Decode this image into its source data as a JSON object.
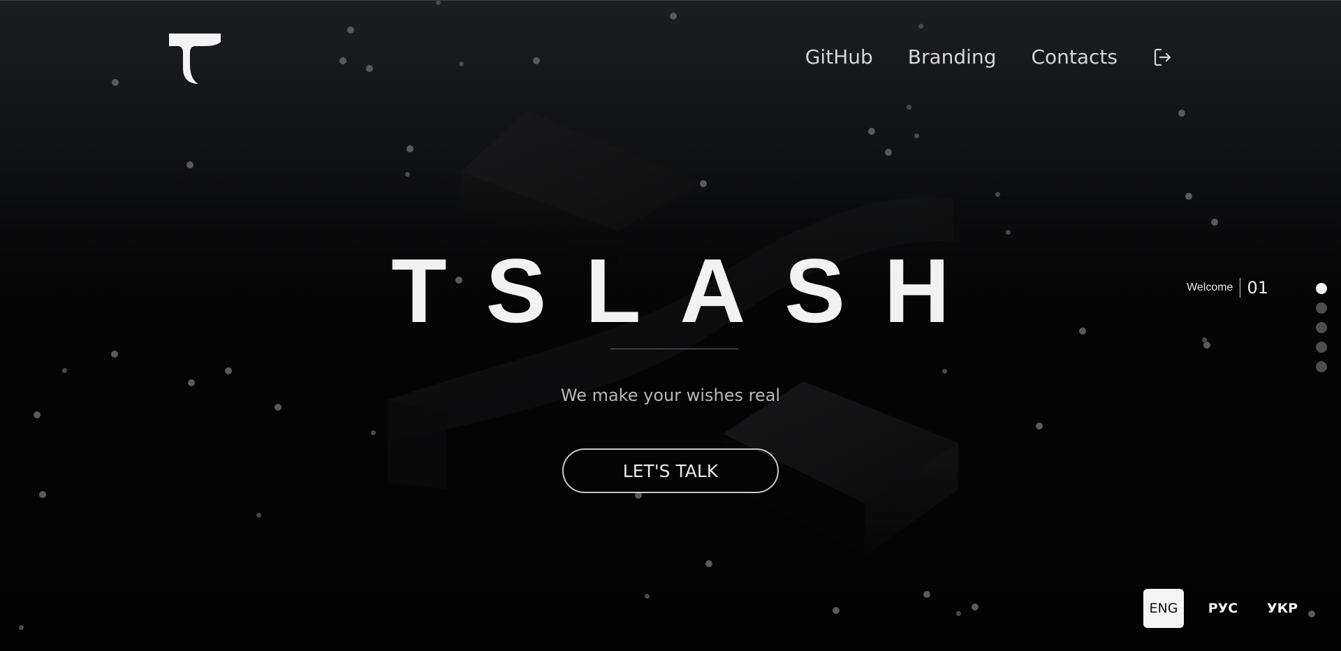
{
  "header": {
    "logo_icon": "tslash-logo-icon",
    "nav": [
      {
        "label": "GitHub"
      },
      {
        "label": "Branding"
      },
      {
        "label": "Contacts"
      }
    ],
    "logout_icon": "logout-icon"
  },
  "hero": {
    "title": "TSLASH",
    "subtitle": "We make your wishes real",
    "cta_label": "LET'S TALK"
  },
  "section_indicator": {
    "name": "Welcome",
    "number": "01",
    "total_dots": 5,
    "active_index": 0
  },
  "languages": [
    {
      "label": "ENG",
      "active": true
    },
    {
      "label": "РУС",
      "active": false
    },
    {
      "label": "УКР",
      "active": false
    }
  ],
  "colors": {
    "background": "#050506",
    "text": "#f2f2f2",
    "muted": "#b9b9b9",
    "particle": "#5a5a5d"
  }
}
